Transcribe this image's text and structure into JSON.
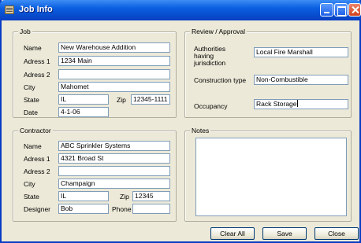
{
  "window": {
    "title": "Job Info"
  },
  "job": {
    "legend": "Job",
    "name_label": "Name",
    "name_value": "New Warehouse Addition",
    "address1_label": "Adress 1",
    "address1_value": "1234 Main",
    "address2_label": "Adress 2",
    "address2_value": "",
    "city_label": "City",
    "city_value": "Mahomet",
    "state_label": "State",
    "state_value": "IL",
    "zip_label": "Zip",
    "zip_value": "12345-1111",
    "date_label": "Date",
    "date_value": "4-1-06"
  },
  "contractor": {
    "legend": "Contractor",
    "name_label": "Name",
    "name_value": "ABC Sprinkler Systems",
    "address1_label": "Adress 1",
    "address1_value": "4321 Broad St",
    "address2_label": "Adress 2",
    "address2_value": "",
    "city_label": "City",
    "city_value": "Champaign",
    "state_label": "State",
    "state_value": "IL",
    "zip_label": "Zip",
    "zip_value": "12345",
    "designer_label": "Designer",
    "designer_value": "Bob",
    "phone_label": "Phone",
    "phone_value": ""
  },
  "review": {
    "legend": "Review / Approval",
    "ahj_label_line1": "Authorities",
    "ahj_label_line2": "having",
    "ahj_label_line3": "jurisdiction",
    "ahj_value": "Local Fire Marshall",
    "construction_label": "Construction type",
    "construction_value": "Non-Combustible",
    "occupancy_label": "Occupancy",
    "occupancy_value": "Rack Storage"
  },
  "notes": {
    "legend": "Notes",
    "value": ""
  },
  "buttons": {
    "clear_all": "Clear All",
    "save": "Save",
    "close": "Close"
  }
}
